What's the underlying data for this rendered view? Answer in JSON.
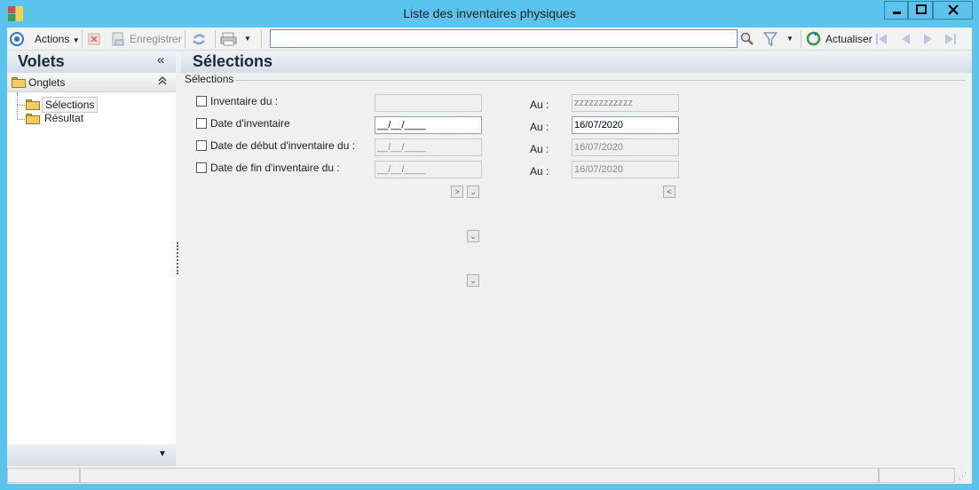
{
  "window": {
    "title": "Liste des inventaires physiques",
    "minimize_glyph": "▬",
    "maximize_glyph": "□",
    "close_glyph": "✕"
  },
  "toolbar": {
    "actions_label": "Actions",
    "save_label": "Enregistrer",
    "refresh_label": "Actualiser",
    "search_value": ""
  },
  "left_pane": {
    "title": "Volets",
    "collapse_glyph": "«",
    "tabs_label": "Onglets",
    "tabs_collapse_glyph": "⌃",
    "items": [
      {
        "label": "Sélections",
        "selected": true
      },
      {
        "label": "Résultat",
        "selected": false
      }
    ],
    "footer_glyph": "▼"
  },
  "main": {
    "title": "Sélections",
    "group_label": "Sélections",
    "rows": [
      {
        "label": "Inventaire du :",
        "from_value": "",
        "to_label": "Au :",
        "to_value": "zzzzzzzzzzzz"
      },
      {
        "label": "Date d'inventaire",
        "from_value": "__/__/____",
        "to_label": "Au :",
        "to_value": "16/07/2020"
      },
      {
        "label": "Date de début d'inventaire du :",
        "from_value": "__/__/____",
        "to_label": "Au :",
        "to_value": "16/07/2020"
      },
      {
        "label": "Date de fin d'inventaire du :",
        "from_value": "__/__/____",
        "to_label": "Au :",
        "to_value": "16/07/2020"
      }
    ]
  },
  "colors": {
    "window_frame": "#5ac4ec",
    "pane_header": "#d4dde8",
    "accent_blue": "#2f6fcf"
  },
  "icons": [
    "app-icon",
    "actions-circle-icon",
    "delete-icon",
    "save-icon",
    "sync-icon",
    "print-icon",
    "search-icon",
    "filter-icon",
    "refresh-icon",
    "first-icon",
    "previous-icon",
    "next-icon",
    "last-icon",
    "folder-icon",
    "calendar-icon",
    "dropdown-icon"
  ]
}
